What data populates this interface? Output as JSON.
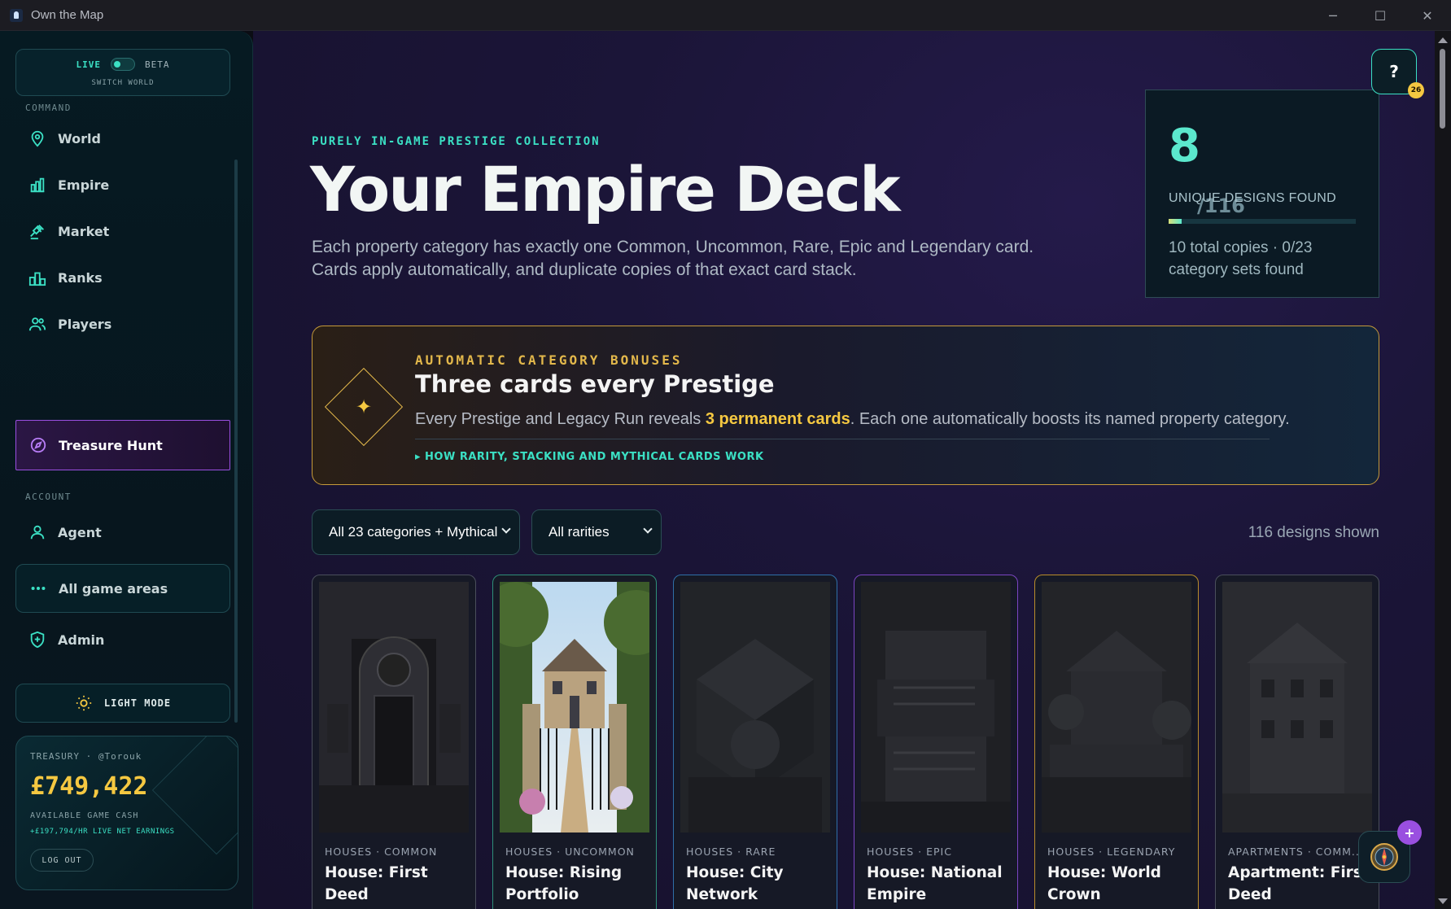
{
  "window": {
    "title": "Own the Map",
    "controls": [
      "─",
      "☐",
      "✕"
    ]
  },
  "sidebar": {
    "world_switch": {
      "live": "LIVE",
      "beta": "BETA",
      "label": "SWITCH WORLD"
    },
    "command_label": "COMMAND",
    "account_label": "ACCOUNT",
    "items": [
      {
        "label": "World",
        "icon": "map-pin-icon"
      },
      {
        "label": "Empire",
        "icon": "chart-bars-icon"
      },
      {
        "label": "Market",
        "icon": "gavel-icon"
      },
      {
        "label": "Ranks",
        "icon": "podium-icon"
      },
      {
        "label": "Players",
        "icon": "users-icon"
      },
      {
        "label": "Treasure Hunt",
        "icon": "compass-icon",
        "active": true
      },
      {
        "label": "Agent",
        "icon": "user-icon"
      },
      {
        "label": "All game areas",
        "icon": "more-dots-icon"
      },
      {
        "label": "Admin",
        "icon": "shield-plus-icon"
      }
    ],
    "light_mode_label": "LIGHT MODE",
    "treasury": {
      "label": "TREASURY · @Torouk",
      "cash": "£749,422",
      "cash_label": "AVAILABLE GAME CASH",
      "earnings": "+£197,794/HR LIVE NET EARNINGS",
      "logout_label": "LOG OUT"
    }
  },
  "main": {
    "eyebrow": "PURELY IN-GAME PRESTIGE COLLECTION",
    "title": "Your Empire Deck",
    "description": "Each property category has exactly one Common, Uncommon, Rare, Epic and Legendary card. Cards apply automatically, and duplicate copies of that exact card stack.",
    "stats": {
      "found": "8",
      "total": "/116",
      "label": "UNIQUE DESIGNS FOUND",
      "progress": 0.069,
      "footer": "10 total copies · 0/23 category sets found"
    },
    "help": {
      "label": "?",
      "badge": "26"
    },
    "bonus": {
      "eyebrow": "AUTOMATIC CATEGORY BONUSES",
      "title": "Three cards every Prestige",
      "text_before": "Every Prestige and Legacy Run reveals ",
      "text_highlight": "3 permanent cards",
      "text_after": ". Each one automatically boosts its named property category.",
      "link": "▸ HOW RARITY, STACKING AND MYTHICAL CARDS WORK"
    },
    "filters": {
      "category": "All 23 categories + Mythical",
      "rarity": "All rarities",
      "shown": "116 designs shown"
    },
    "cards": [
      {
        "meta": "HOUSES · COMMON",
        "name": "House: First Deed",
        "border": "#4a4f5c"
      },
      {
        "meta": "HOUSES · UNCOMMON",
        "name": "House: Rising Portfolio",
        "border": "#2e8f78"
      },
      {
        "meta": "HOUSES · RARE",
        "name": "House: City Network",
        "border": "#2f6fa8"
      },
      {
        "meta": "HOUSES · EPIC",
        "name": "House: National Empire",
        "border": "#7a45c2"
      },
      {
        "meta": "HOUSES · LEGENDARY",
        "name": "House: World Crown",
        "border": "#b98d2a"
      },
      {
        "meta": "APARTMENTS · COMM...",
        "name": "Apartment: First Deed",
        "border": "#4a4f5c"
      }
    ],
    "fab_badge": "+"
  }
}
